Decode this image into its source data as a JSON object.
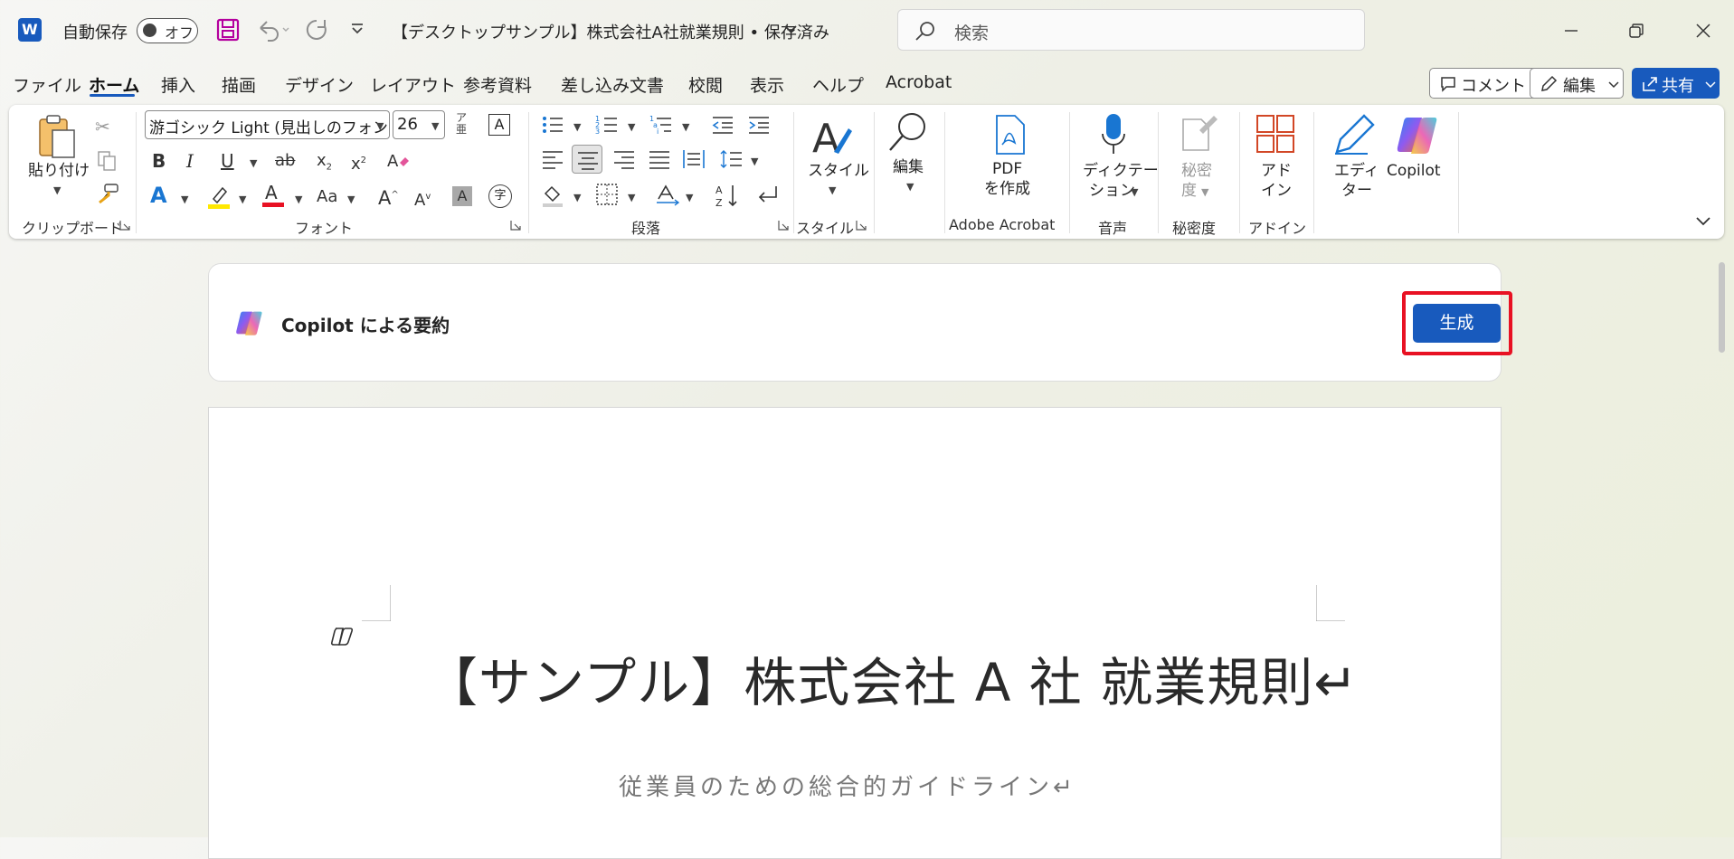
{
  "titlebar": {
    "app_icon": "word-icon",
    "autosave_label": "自動保存",
    "autosave_state": "オフ",
    "doc_title": "【デスクトップサンプル】株式会社A社就業規則 • 保存済み",
    "search_placeholder": "検索"
  },
  "tabs": [
    "ファイル",
    "ホーム",
    "挿入",
    "描画",
    "デザイン",
    "レイアウト",
    "参考資料",
    "差し込み文書",
    "校閲",
    "表示",
    "ヘルプ",
    "Acrobat"
  ],
  "active_tab": "ホーム",
  "right_buttons": {
    "comment": "コメント",
    "edit": "編集",
    "share": "共有"
  },
  "ribbon": {
    "paste_label": "貼り付け",
    "font_name": "游ゴシック Light (見出しのフォント",
    "font_size": "26",
    "styles_label": "スタイル",
    "edit_label": "編集",
    "pdf_label_1": "PDF",
    "pdf_label_2": "を作成",
    "dictate_label_1": "ディクテー",
    "dictate_label_2": "ション",
    "sensitivity_label_1": "秘密",
    "sensitivity_label_2": "度",
    "addin_label_1": "アド",
    "addin_label_2": "イン",
    "editor_label_1": "エディ",
    "editor_label_2": "ター",
    "copilot_label": "Copilot",
    "groups": {
      "clipboard": "クリップボード",
      "font": "フォント",
      "paragraph": "段落",
      "style": "スタイル",
      "adobe": "Adobe Acrobat",
      "voice": "音声",
      "sensitivity": "秘密度",
      "addin": "アドイン"
    }
  },
  "summary": {
    "title": "Copilot による要約",
    "generate_label": "生成"
  },
  "document": {
    "title": "【サンプル】株式会社 A 社  就業規則↵",
    "subtitle": "従業員のための総合的ガイドライン↵"
  },
  "colors": {
    "accent": "#185abd",
    "highlight_box": "#e81123"
  }
}
